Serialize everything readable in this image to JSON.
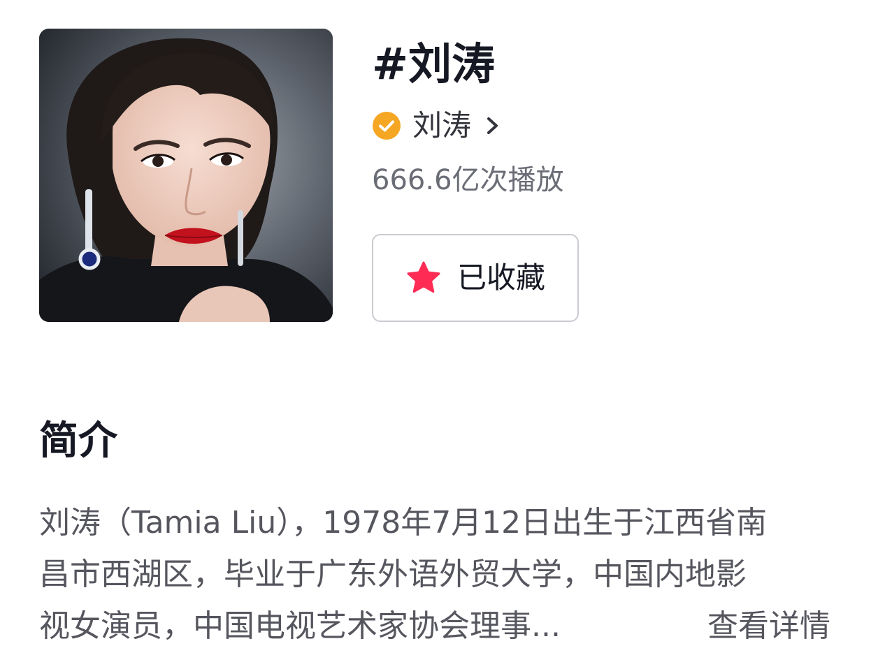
{
  "topic": {
    "title": "#刘涛",
    "creator_name": "刘涛",
    "play_count": "666.6亿次播放",
    "favorite_label": "已收藏"
  },
  "intro": {
    "heading": "简介",
    "lines": [
      "刘涛（Tamia Liu），1978年7月12日出生于江西省南",
      "昌市西湖区，毕业于广东外语外贸大学，中国内地影",
      "视女演员，中国电视艺术家协会理事..."
    ],
    "more_label": "查看详情"
  },
  "colors": {
    "verified_badge": "#f5a623",
    "star": "#fe2c55",
    "primary_text": "#161823",
    "secondary_text": "#6b6d76"
  },
  "icons": [
    "verified-icon",
    "chevron-right-icon",
    "star-icon"
  ]
}
